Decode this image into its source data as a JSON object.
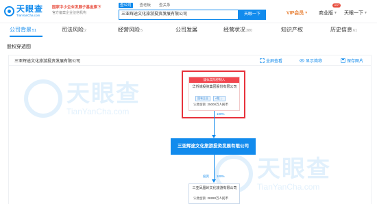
{
  "header": {
    "logo_main": "天眼查",
    "logo_sub": "TianYanCha.com",
    "promo_line1": "国家中小企业发展子基金旗下",
    "promo_line2": "官方备案企业征信机构",
    "search_tabs": [
      "查公司",
      "查老板",
      "查关系"
    ],
    "search_value": "三亚辉途文化旅游投资发展有限公司",
    "search_button": "天眼一下",
    "vip_label": "VIP会员",
    "biz_label": "商业版",
    "hot_badge": "HOT",
    "login_label": "天眼一下"
  },
  "tabs": [
    {
      "label": "公司背景",
      "count": "51"
    },
    {
      "label": "司法风险",
      "count": "2"
    },
    {
      "label": "经营风险",
      "count": "5"
    },
    {
      "label": "公司发展",
      "count": ""
    },
    {
      "label": "经营状况",
      "count": "380"
    },
    {
      "label": "知识产权",
      "count": ""
    },
    {
      "label": "历史信息",
      "count": "61"
    }
  ],
  "section_title": "股权穿透图",
  "toolbar": {
    "company": "三亚辉途文化旅游投资发展有限公司",
    "fullscreen": "全屏查看",
    "show_short": "显示简称",
    "save_image": "保存图片"
  },
  "graph": {
    "holder_tag": "疑似实际控制人",
    "holder_name": "华侨城投资集团股份有限公司",
    "holder_badges": [
      "国有企业",
      "A股 |..."
    ],
    "holder_capital_label": "认缴金额:",
    "holder_capital_value": "25000万人民币",
    "holder_pct": "100%",
    "main_company": "三亚辉途文化旅游投资发展有限公司",
    "child_label": "投资",
    "child_pct": "100%",
    "child_name": "三亚凤凰岭文化旅游有限公司",
    "child_capital_label": "认缴金额:",
    "child_capital_value": "28280万人民币"
  },
  "colors": {
    "brand": "#128bed",
    "highlight": "#e7313b",
    "vip": "#e8833a"
  }
}
